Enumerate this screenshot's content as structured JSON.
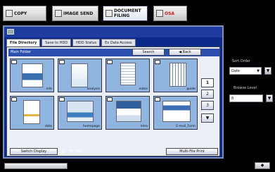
{
  "mode_tabs": {
    "copy": "COPY",
    "image_send_1": "IMAGE",
    "image_send_2": "SEND",
    "document_filing_1": "DOCUMENT",
    "document_filing_2": "FILING",
    "osa": "OSA"
  },
  "tabs": [
    "File Directory",
    "Save to HDD",
    "HDD Status",
    "Ex Data Access"
  ],
  "path_label": "Main Folder",
  "buttons": {
    "search": "Search",
    "back": "Back",
    "switch_display": "Switch Display",
    "file_count": "40 Files",
    "multi_file_print": "Multi-File Print"
  },
  "thumbnails": [
    {
      "caption": "info"
    },
    {
      "caption": "analysis"
    },
    {
      "caption": "notes"
    },
    {
      "caption": "guide"
    },
    {
      "caption": "data"
    },
    {
      "caption": "homepage"
    },
    {
      "caption": "intro"
    },
    {
      "caption": "E-mail_Form"
    }
  ],
  "pager": {
    "pages": [
      "1",
      "2",
      "3"
    ],
    "current": "1"
  },
  "side": {
    "sort_label": "Sort Order",
    "sort_value": "Date",
    "browse_label": "Browse Level",
    "browse_value": "8"
  },
  "colors": {
    "window_bg": "#0b2a8a",
    "path_bar": "#2d4fae",
    "thumb_bg": "#8fb4e0"
  }
}
